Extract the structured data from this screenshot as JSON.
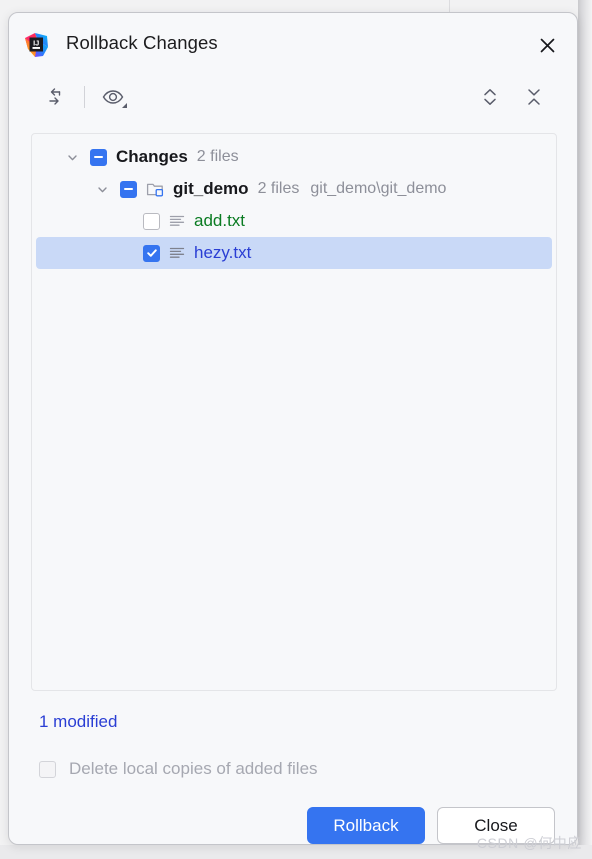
{
  "dialog": {
    "title": "Rollback Changes",
    "app_icon": "intellij-idea-icon",
    "close_icon": "close-icon"
  },
  "toolbar": {
    "rollback_icon": "rollback-arrows-icon",
    "preview_icon": "eye-preview-icon",
    "expand_all_icon": "expand-all-icon",
    "collapse_all_icon": "collapse-all-icon"
  },
  "tree": {
    "rows": [
      {
        "label": "Changes",
        "meta": "2 files",
        "path": "",
        "checkbox": "indeterminate",
        "twisty": "chevron-down-icon",
        "icon": "",
        "selected": false,
        "depth": 0
      },
      {
        "label": "git_demo",
        "meta": "2 files",
        "path": "git_demo\\git_demo",
        "checkbox": "indeterminate",
        "twisty": "chevron-down-icon",
        "icon": "folder-module-icon",
        "selected": false,
        "depth": 1
      },
      {
        "label": "add.txt",
        "meta": "",
        "path": "",
        "checkbox": "unchecked",
        "twisty": "",
        "icon": "text-file-icon",
        "status": "added",
        "selected": false,
        "depth": 2
      },
      {
        "label": "hezy.txt",
        "meta": "",
        "path": "",
        "checkbox": "checked",
        "twisty": "",
        "icon": "text-file-icon",
        "status": "modified",
        "selected": true,
        "depth": 2
      }
    ]
  },
  "summary": "1 modified",
  "option": {
    "label": "Delete local copies of added files",
    "checked": false,
    "disabled": true
  },
  "buttons": {
    "primary": "Rollback",
    "secondary": "Close"
  },
  "watermark": "CSDN @何中应",
  "colors": {
    "accent": "#3574f0",
    "selection": "#c9d9f7",
    "added": "#0a7b22",
    "modified": "#2a3ed4",
    "muted": "#8d8f99",
    "dialog_bg": "#f7f8fa"
  }
}
